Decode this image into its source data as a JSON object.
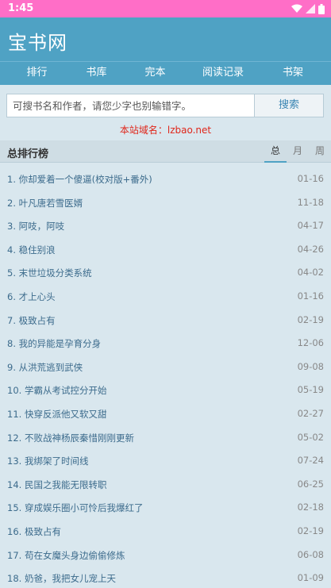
{
  "status": {
    "time": "1:45"
  },
  "header": {
    "title": "宝书网"
  },
  "nav": [
    "排行",
    "书库",
    "完本",
    "阅读记录",
    "书架"
  ],
  "search": {
    "placeholder": "可搜书名和作者，请您少字也别输错字。",
    "button": "搜索"
  },
  "domain_notice": "本站域名：lzbao.net",
  "ranking": {
    "title": "总排行榜",
    "tabs": [
      "总",
      "月",
      "周"
    ],
    "active_tab": "总",
    "items": [
      {
        "name": "1. 你却爱着一个傻逼(校对版+番外)",
        "date": "01-16"
      },
      {
        "name": "2. 叶凡唐若雪医婿",
        "date": "11-18"
      },
      {
        "name": "3. 阿吱，阿吱",
        "date": "04-17"
      },
      {
        "name": "4. 稳住别浪",
        "date": "04-26"
      },
      {
        "name": "5. 末世垃圾分类系统",
        "date": "04-02"
      },
      {
        "name": "6. 才上心头",
        "date": "01-16"
      },
      {
        "name": "7. 极致占有",
        "date": "02-19"
      },
      {
        "name": "8. 我的异能是孕育分身",
        "date": "12-06"
      },
      {
        "name": "9. 从洪荒逃到武侠",
        "date": "09-08"
      },
      {
        "name": "10. 学霸从考试控分开始",
        "date": "05-19"
      },
      {
        "name": "11. 快穿反派他又软又甜",
        "date": "02-27"
      },
      {
        "name": "12. 不败战神杨辰秦惜刚刚更新",
        "date": "05-02"
      },
      {
        "name": "13. 我绑架了时间线",
        "date": "07-24"
      },
      {
        "name": "14. 民国之我能无限转职",
        "date": "06-25"
      },
      {
        "name": "15. 穿成娱乐圈小可怜后我爆红了",
        "date": "02-18"
      },
      {
        "name": "16. 极致占有",
        "date": "02-19"
      },
      {
        "name": "17. 苟在女魔头身边偷偷修炼",
        "date": "06-08"
      },
      {
        "name": "18. 奶爸，我把女儿宠上天",
        "date": "01-09"
      }
    ]
  }
}
